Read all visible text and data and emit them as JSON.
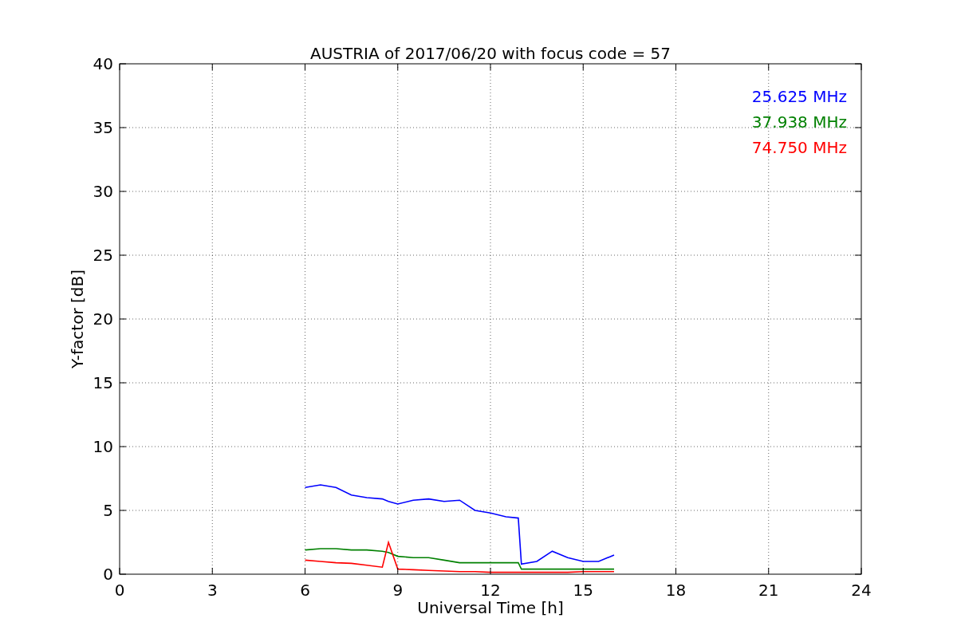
{
  "chart_data": {
    "type": "line",
    "title": "AUSTRIA of 2017/06/20 with focus code = 57",
    "xlabel": "Universal Time [h]",
    "ylabel": "Y-factor [dB]",
    "x": [
      6,
      6.5,
      7,
      7.5,
      8,
      8.5,
      8.7,
      9,
      9.5,
      10,
      10.5,
      11,
      11.5,
      12,
      12.5,
      12.9,
      13,
      13.5,
      14,
      14.5,
      15,
      15.5,
      16
    ],
    "series": [
      {
        "name": "25.625 MHz",
        "color": "#0000ff",
        "values": [
          6.8,
          7.0,
          6.8,
          6.2,
          6.0,
          5.9,
          5.7,
          5.5,
          5.8,
          5.9,
          5.7,
          5.8,
          5.0,
          4.8,
          4.5,
          4.4,
          0.8,
          1.0,
          1.8,
          1.3,
          1.0,
          1.0,
          1.5
        ]
      },
      {
        "name": "37.938 MHz",
        "color": "#008000",
        "values": [
          1.9,
          2.0,
          2.0,
          1.9,
          1.9,
          1.8,
          1.7,
          1.4,
          1.3,
          1.3,
          1.1,
          0.9,
          0.9,
          0.9,
          0.9,
          0.9,
          0.4,
          0.4,
          0.4,
          0.4,
          0.4,
          0.4,
          0.4
        ]
      },
      {
        "name": "74.750 MHz",
        "color": "#ff0000",
        "values": [
          1.1,
          1.0,
          0.9,
          0.85,
          0.7,
          0.55,
          2.5,
          0.4,
          0.35,
          0.3,
          0.25,
          0.2,
          0.2,
          0.15,
          0.15,
          0.15,
          0.15,
          0.15,
          0.15,
          0.15,
          0.2,
          0.2,
          0.2
        ]
      }
    ],
    "xlim": [
      0,
      24
    ],
    "ylim": [
      0,
      40
    ],
    "xticks": [
      0,
      3,
      6,
      9,
      12,
      15,
      18,
      21,
      24
    ],
    "yticks": [
      0,
      5,
      10,
      15,
      20,
      25,
      30,
      35,
      40
    ],
    "grid": true
  }
}
